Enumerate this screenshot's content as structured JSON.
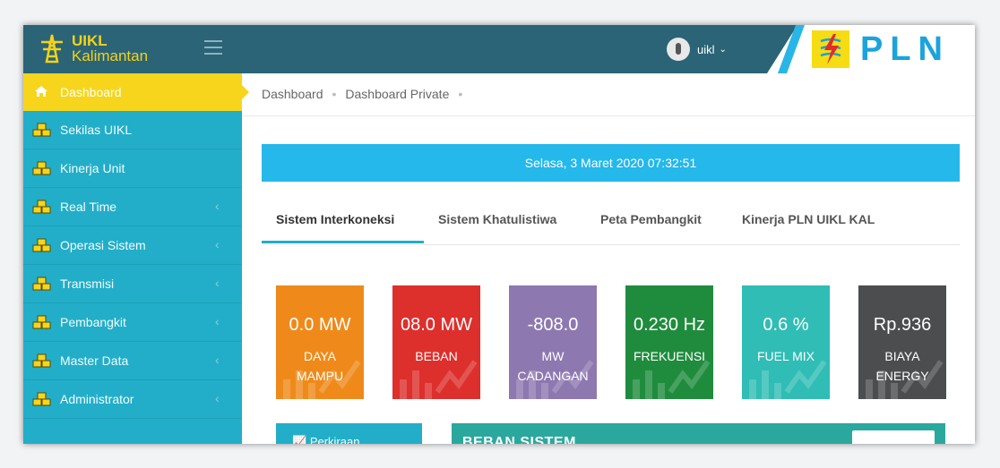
{
  "brand": {
    "line1": "UIKL",
    "line2": "Kalimantan",
    "logo_icon": "transmission-tower-icon"
  },
  "header": {
    "user_name": "uikl",
    "logo_text": "PLN",
    "accent": "#2a6476",
    "logo_icon": "pln-lightning-icon"
  },
  "sidebar": {
    "items": [
      {
        "label": "Dashboard",
        "icon": "home-icon",
        "has_caret": false,
        "active": true
      },
      {
        "label": "Sekilas UIKL",
        "icon": "cubes-icon",
        "has_caret": false
      },
      {
        "label": "Kinerja Unit",
        "icon": "cubes-icon",
        "has_caret": false
      },
      {
        "label": "Real Time",
        "icon": "cubes-icon",
        "has_caret": true
      },
      {
        "label": "Operasi Sistem",
        "icon": "cubes-icon",
        "has_caret": true
      },
      {
        "label": "Transmisi",
        "icon": "cubes-icon",
        "has_caret": true
      },
      {
        "label": "Pembangkit",
        "icon": "cubes-icon",
        "has_caret": true
      },
      {
        "label": "Master Data",
        "icon": "cubes-icon",
        "has_caret": true
      },
      {
        "label": "Administrator",
        "icon": "cubes-icon",
        "has_caret": true
      }
    ],
    "caret": "‹"
  },
  "breadcrumb": {
    "items": [
      "Dashboard",
      "Dashboard Private"
    ],
    "sep": "•"
  },
  "datebar": {
    "text": "Selasa, 3 Maret 2020 07:32:51"
  },
  "tabs": [
    "Sistem Interkoneksi",
    "Sistem Khatulistiwa",
    "Peta Pembangkit",
    "Kinerja PLN UIKL KAL"
  ],
  "tiles": [
    {
      "value": "0.0 MW",
      "caption_l1": "DAYA",
      "caption_l2": "MAMPU",
      "color": "#ef8a1a"
    },
    {
      "value": "08.0 MW",
      "caption_l1": "BEBAN",
      "caption_l2": "",
      "color": "#dd2f2c"
    },
    {
      "value": "-808.0",
      "caption_l1": "MW",
      "caption_l2": "CADANGAN",
      "color": "#8e78b0"
    },
    {
      "value": "0.230 Hz",
      "caption_l1": "FREKUENSI",
      "caption_l2": "",
      "color": "#1f8c3d"
    },
    {
      "value": "0.6 %",
      "caption_l1": "FUEL MIX",
      "caption_l2": "",
      "color": "#2fbdb5"
    },
    {
      "value": "Rp.936",
      "caption_l1": "BIAYA",
      "caption_l2": "ENERGY",
      "color": "#4b4d4f"
    }
  ],
  "panels": {
    "left_title": "Perkiraan",
    "right_title": "BEBAN SISTEM"
  }
}
